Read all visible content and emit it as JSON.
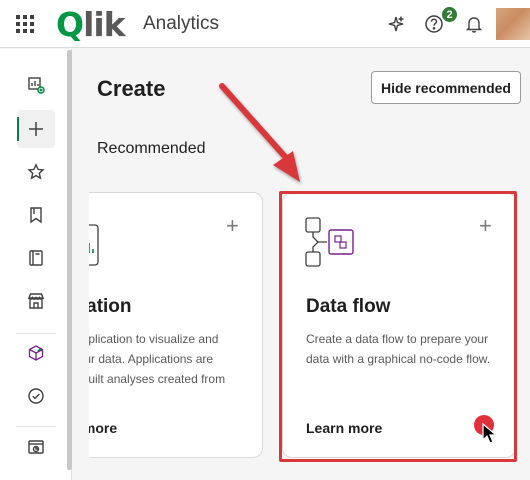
{
  "header": {
    "brand": {
      "q": "Q",
      "rest": "lik"
    },
    "product": "Analytics",
    "help_badge": "2",
    "icons": [
      "apps-grid-icon",
      "sparkle-icon",
      "help-icon",
      "bell-icon"
    ]
  },
  "sidebar": {
    "items": [
      {
        "name": "insights",
        "icon": "chart-add-icon"
      },
      {
        "name": "create",
        "icon": "plus-icon",
        "active": true
      },
      {
        "name": "favorites",
        "icon": "star-icon"
      },
      {
        "name": "collections",
        "icon": "bookmark-icon"
      },
      {
        "name": "catalog",
        "icon": "book-icon"
      },
      {
        "name": "marketplace",
        "icon": "store-icon"
      },
      {
        "name": "automations",
        "icon": "cube-icon"
      },
      {
        "name": "tasks",
        "icon": "check-circle-icon"
      },
      {
        "name": "activity",
        "icon": "analytics-icon"
      }
    ]
  },
  "main": {
    "title": "Create",
    "hide_button": "Hide recommended",
    "section": "Recommended",
    "cards": [
      {
        "id": "analytics-app",
        "title": "lication",
        "desc": [
          "n application to visualize and",
          "t your data. Applications are",
          "se-built analyses created from"
        ],
        "link": "rn more"
      },
      {
        "id": "data-flow",
        "title": "Data flow",
        "desc": [
          "Create a data flow to prepare your",
          "data with a graphical no-code flow."
        ],
        "link": "Learn more"
      }
    ]
  },
  "annotation": {
    "highlight_color": "#d9383a",
    "cursor_dot_color": "#e0303a"
  },
  "colors": {
    "brand_green": "#009845",
    "badge_green": "#2e7d32",
    "flow_icon": "#7b1f8c"
  }
}
